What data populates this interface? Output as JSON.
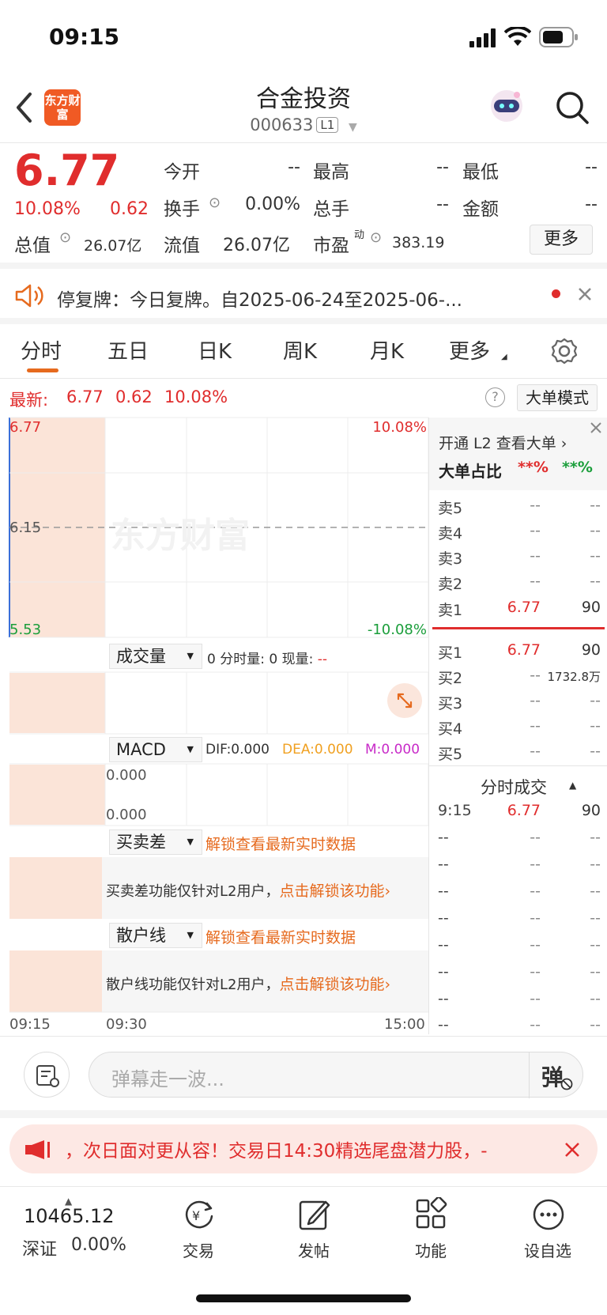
{
  "status_bar": {
    "time": "09:15"
  },
  "header": {
    "logo_text": "东方财富",
    "title": "合金投资",
    "code": "000633",
    "level_badge": "L1"
  },
  "quote": {
    "price": "6.77",
    "change_pct": "10.08%",
    "change": "0.62",
    "open_label": "今开",
    "open": "--",
    "high_label": "最高",
    "high": "--",
    "low_label": "最低",
    "low": "--",
    "turnover_label": "换手",
    "turnover": "0.00%",
    "volume_label": "总手",
    "volume": "--",
    "amount_label": "金额",
    "amount": "--",
    "total_value_label": "总值",
    "total_value": "26.07亿",
    "float_value_label": "流值",
    "float_value": "26.07亿",
    "pe_label": "市盈",
    "pe_superscript": "动",
    "pe": "383.19",
    "more_button": "更多"
  },
  "notice": {
    "text": "停复牌：今日复牌。自2025-06-24至2025-06-..."
  },
  "tabs": [
    "分时",
    "五日",
    "日K",
    "周K",
    "月K",
    "更多"
  ],
  "latest": {
    "label": "最新:",
    "price": "6.77",
    "change": "0.62",
    "pct": "10.08%",
    "help_icon": "?",
    "big_order_mode": "大单模式"
  },
  "chart": {
    "price_top": "6.77",
    "price_mid": "6.15",
    "price_bottom": "5.53",
    "pct_top": "10.08%",
    "pct_bottom": "-10.08%",
    "watermark": "东方财富",
    "volume_selector": "成交量",
    "volume_info": "0 分时量: 0 现量:",
    "volume_now": "--",
    "macd_selector": "MACD",
    "dif": "DIF:0.000",
    "dea": "DEA:0.000",
    "m": "M:0.000",
    "macd_top": "0.000",
    "macd_bottom": "0.000",
    "spread_selector": "买卖差",
    "spread_lock": "解锁查看最新实时数据",
    "spread_note": "买卖差功能仅针对L2用户，",
    "spread_unlock": "点击解锁该功能",
    "retail_selector": "散户线",
    "retail_lock": "解锁查看最新实时数据",
    "retail_note": "散户线功能仅针对L2用户，",
    "retail_unlock": "点击解锁该功能",
    "time_start": "09:15",
    "time_mid": "09:30",
    "time_end": "15:00"
  },
  "order_book": {
    "l2_link": "开通 L2 查看大单",
    "big_ratio_label": "大单占比",
    "big_buy": "**%",
    "big_sell": "**%",
    "sells": [
      {
        "label": "卖5",
        "price": "--",
        "vol": "--"
      },
      {
        "label": "卖4",
        "price": "--",
        "vol": "--"
      },
      {
        "label": "卖3",
        "price": "--",
        "vol": "--"
      },
      {
        "label": "卖2",
        "price": "--",
        "vol": "--"
      },
      {
        "label": "卖1",
        "price": "6.77",
        "vol": "90"
      }
    ],
    "buys": [
      {
        "label": "买1",
        "price": "6.77",
        "vol": "90"
      },
      {
        "label": "买2",
        "price": "--",
        "vol": "1732.8万"
      },
      {
        "label": "买3",
        "price": "--",
        "vol": "--"
      },
      {
        "label": "买4",
        "price": "--",
        "vol": "--"
      },
      {
        "label": "买5",
        "price": "--",
        "vol": "--"
      }
    ],
    "ticks_title": "分时成交",
    "ticks": [
      {
        "time": "9:15",
        "price": "6.77",
        "vol": "90"
      },
      {
        "time": "--",
        "price": "--",
        "vol": "--"
      },
      {
        "time": "--",
        "price": "--",
        "vol": "--"
      },
      {
        "time": "--",
        "price": "--",
        "vol": "--"
      },
      {
        "time": "--",
        "price": "--",
        "vol": "--"
      },
      {
        "time": "--",
        "price": "--",
        "vol": "--"
      },
      {
        "time": "--",
        "price": "--",
        "vol": "--"
      },
      {
        "time": "--",
        "price": "--",
        "vol": "--"
      },
      {
        "time": "--",
        "price": "--",
        "vol": "--"
      }
    ]
  },
  "danmaku": {
    "placeholder": "弹幕走一波...",
    "button": "弹"
  },
  "banner": {
    "text": "，次日面对更从容！交易日14:30精选尾盘潜力股，-"
  },
  "bottom_nav": {
    "index_value": "10465.12",
    "index_name": "深证",
    "index_pct": "0.00%",
    "items": [
      "交易",
      "发帖",
      "功能",
      "设自选"
    ]
  }
}
